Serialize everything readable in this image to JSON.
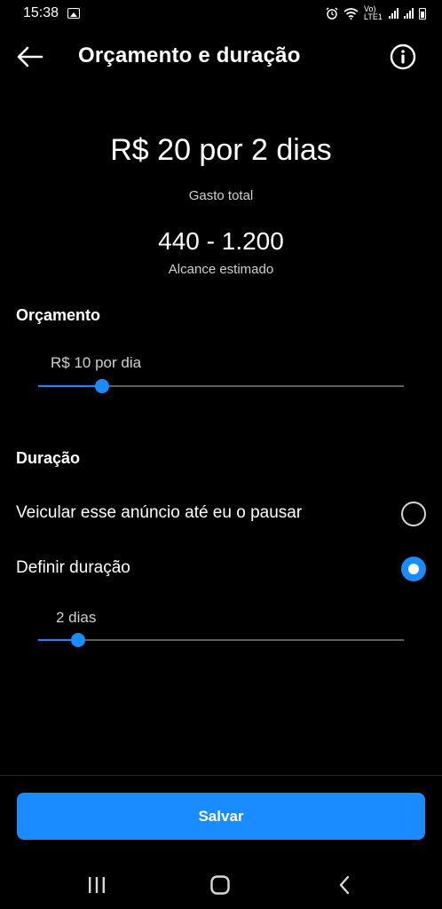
{
  "status_bar": {
    "time": "15:38",
    "network": "Vo) LTE1"
  },
  "header": {
    "title": "Orçamento e duração",
    "back_icon": "arrow-left-icon",
    "info_icon": "info-icon"
  },
  "summary": {
    "main": "R$ 20 por 2 dias",
    "total_label": "Gasto total",
    "reach_value": "440 - 1.200",
    "reach_label": "Alcance estimado"
  },
  "budget": {
    "section_title": "Orçamento",
    "value_label": "R$ 10 por dia",
    "slider_level": 0.175
  },
  "duration": {
    "section_title": "Duração",
    "options": [
      {
        "label": "Veicular esse anúncio até eu o pausar",
        "selected": false
      },
      {
        "label": "Definir duração",
        "selected": true
      }
    ],
    "value_label": "2 dias",
    "slider_level": 0.11
  },
  "footer": {
    "save_label": "Salvar"
  },
  "colors": {
    "accent": "#1a8cff",
    "background": "#000000"
  }
}
